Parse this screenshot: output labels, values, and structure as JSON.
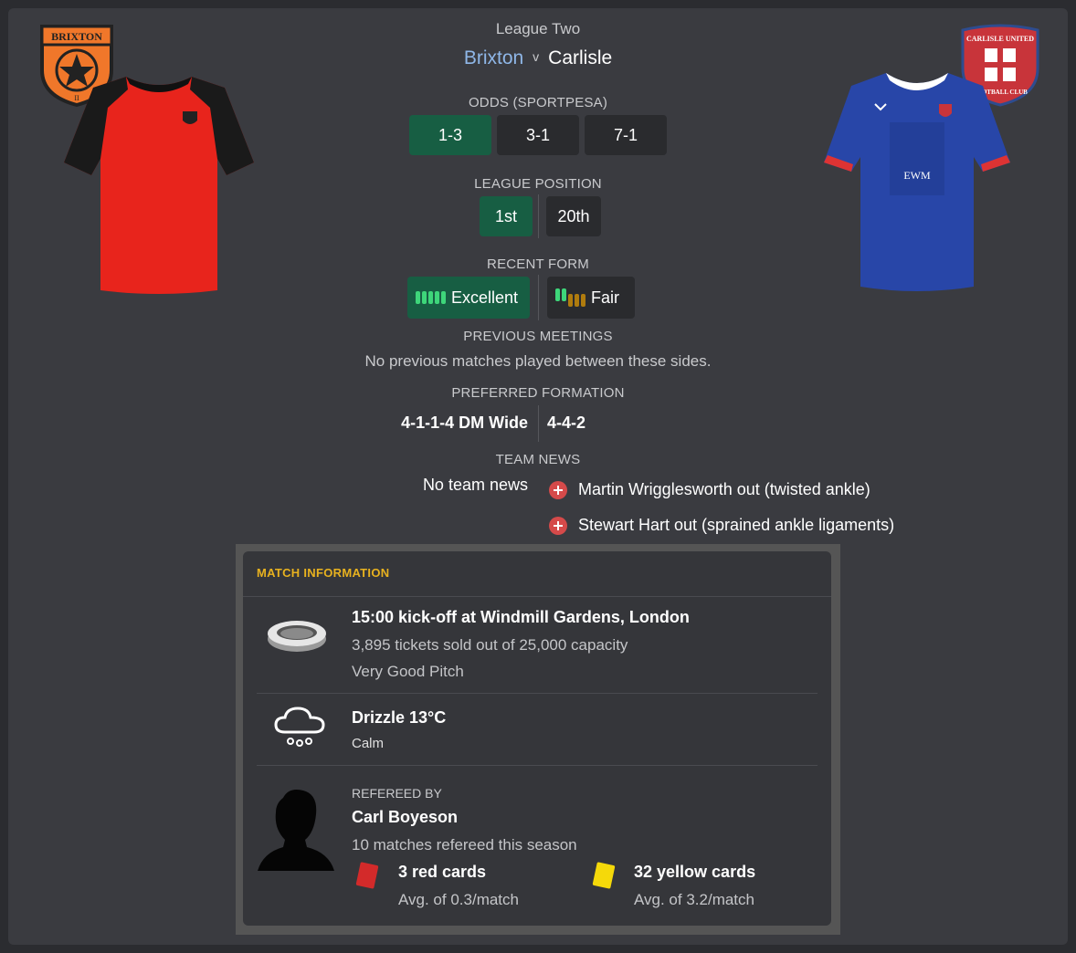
{
  "competition": "League Two",
  "home": {
    "name": "Brixton",
    "badge_text": "BRIXTON",
    "badge_sub": "II"
  },
  "vs": "v",
  "away": {
    "name": "Carlisle",
    "badge_text": "CARLISLE UNITED",
    "badge_sub": "FOOTBALL CLUB",
    "shirt_sponsor": "EWM"
  },
  "odds": {
    "header": "ODDS (SPORTPESA)",
    "values": [
      "1-3",
      "3-1",
      "7-1"
    ]
  },
  "league_position": {
    "header": "LEAGUE POSITION",
    "home": "1st",
    "away": "20th"
  },
  "recent_form": {
    "header": "RECENT FORM",
    "home": "Excellent",
    "away": "Fair"
  },
  "previous_meetings": {
    "header": "PREVIOUS MEETINGS",
    "text": "No previous matches played between these sides."
  },
  "preferred_formation": {
    "header": "PREFERRED FORMATION",
    "home": "4-1-1-4 DM Wide",
    "away": "4-4-2"
  },
  "team_news": {
    "header": "TEAM NEWS",
    "home": "No team news",
    "away": [
      "Martin Wrigglesworth out (twisted ankle)",
      "Stewart Hart out (sprained ankle ligaments)"
    ]
  },
  "match_information": {
    "title": "MATCH INFORMATION",
    "venue": {
      "headline": "15:00 kick-off at Windmill Gardens, London",
      "tickets": "3,895 tickets sold out of 25,000 capacity",
      "pitch": "Very Good Pitch"
    },
    "weather": {
      "headline": "Drizzle 13°C",
      "wind": "Calm"
    },
    "referee": {
      "label": "REFEREED BY",
      "name": "Carl Boyeson",
      "matches": "10 matches refereed this season",
      "red_cards": "3 red cards",
      "red_avg": "Avg. of 0.3/match",
      "yellow_cards": "32 yellow cards",
      "yellow_avg": "Avg. of 3.2/match"
    }
  },
  "colors": {
    "accent_green": "#175e43",
    "home_link": "#8fb7e8",
    "section_title": "#e8b21f",
    "red_card": "#d32a2a",
    "yellow_card": "#f5d90a"
  }
}
